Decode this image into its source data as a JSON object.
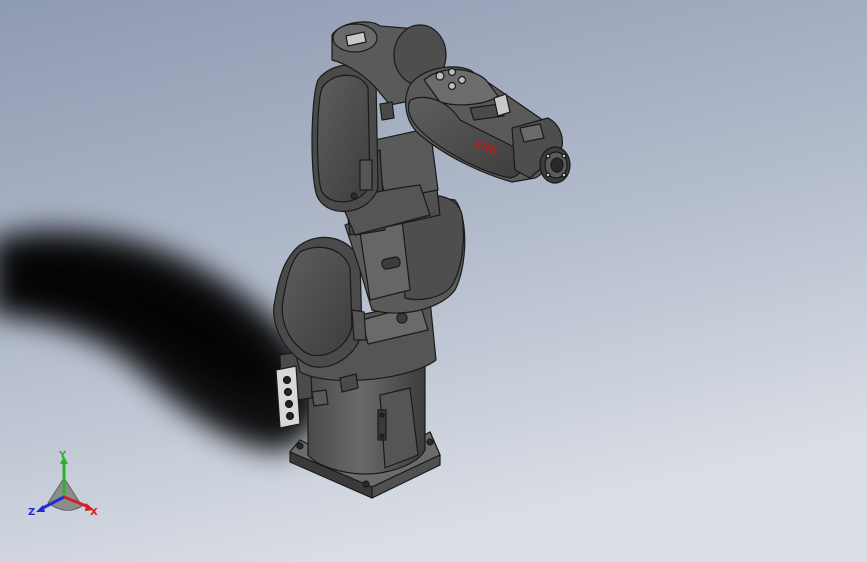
{
  "viewport": {
    "background_top": "#8f9cb4",
    "background_bottom": "#d6dbe4",
    "model_color": "#5d5d5d",
    "edge_color": "#1a1a1a"
  },
  "model": {
    "brand_label": "ABB",
    "brand_color": "#b41e1e"
  },
  "triad": {
    "y_label": "Y",
    "x_label": "X",
    "z_label": "Z",
    "y_color": "#2fb02f",
    "x_color": "#d42020",
    "z_color": "#1f2fd0"
  }
}
